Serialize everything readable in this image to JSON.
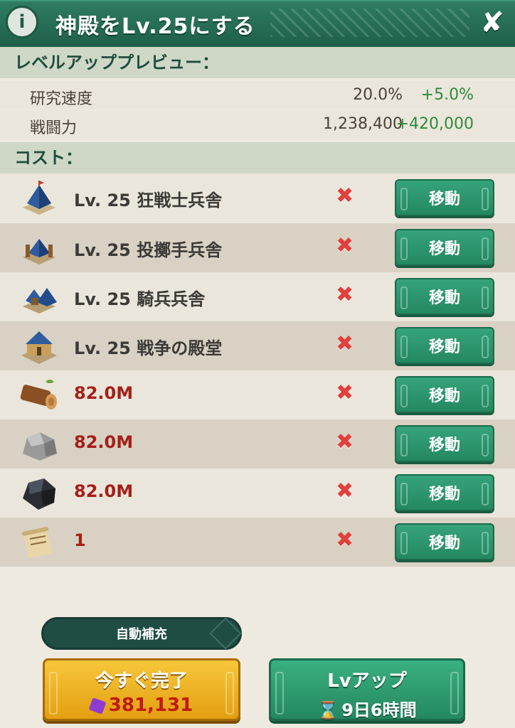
{
  "header": {
    "info_icon": "i",
    "title": "神殿をLv.25にする",
    "close_icon": "✘"
  },
  "preview": {
    "label": "レベルアッププレビュー：",
    "rows": [
      {
        "label": "研究速度",
        "current": "20.0%",
        "increase": "+5.0%"
      },
      {
        "label": "戦闘力",
        "current": "1,238,400",
        "increase": "+420,000"
      }
    ]
  },
  "cost": {
    "label": "コスト：",
    "rows": [
      {
        "icon": "barracks-icon",
        "name": "Lv. 25  狂戦士兵舎",
        "status": "✖",
        "button": "移動"
      },
      {
        "icon": "archery-range-icon",
        "name": "Lv. 25  投擲手兵舎",
        "status": "✖",
        "button": "移動"
      },
      {
        "icon": "stable-icon",
        "name": "Lv. 25  騎兵兵舎",
        "status": "✖",
        "button": "移動"
      },
      {
        "icon": "hall-of-war-icon",
        "name": "Lv. 25  戦争の殿堂",
        "status": "✖",
        "button": "移動"
      },
      {
        "icon": "wood-icon",
        "name": "82.0M",
        "status": "✖",
        "button": "移動"
      },
      {
        "icon": "stone-icon",
        "name": "82.0M",
        "status": "✖",
        "button": "移動"
      },
      {
        "icon": "iron-icon",
        "name": "82.0M",
        "status": "✖",
        "button": "移動"
      },
      {
        "icon": "scroll-icon",
        "name": "1",
        "status": "✖",
        "button": "移動"
      }
    ]
  },
  "autofill": {
    "label": "自動補充"
  },
  "instant": {
    "label": "今すぐ完了",
    "cost": "381,131"
  },
  "levelup": {
    "label": "Lvアップ",
    "time": "9日6時間"
  },
  "colors": {
    "green": "#248860",
    "gold": "#e39f12",
    "red": "#a51f18"
  }
}
